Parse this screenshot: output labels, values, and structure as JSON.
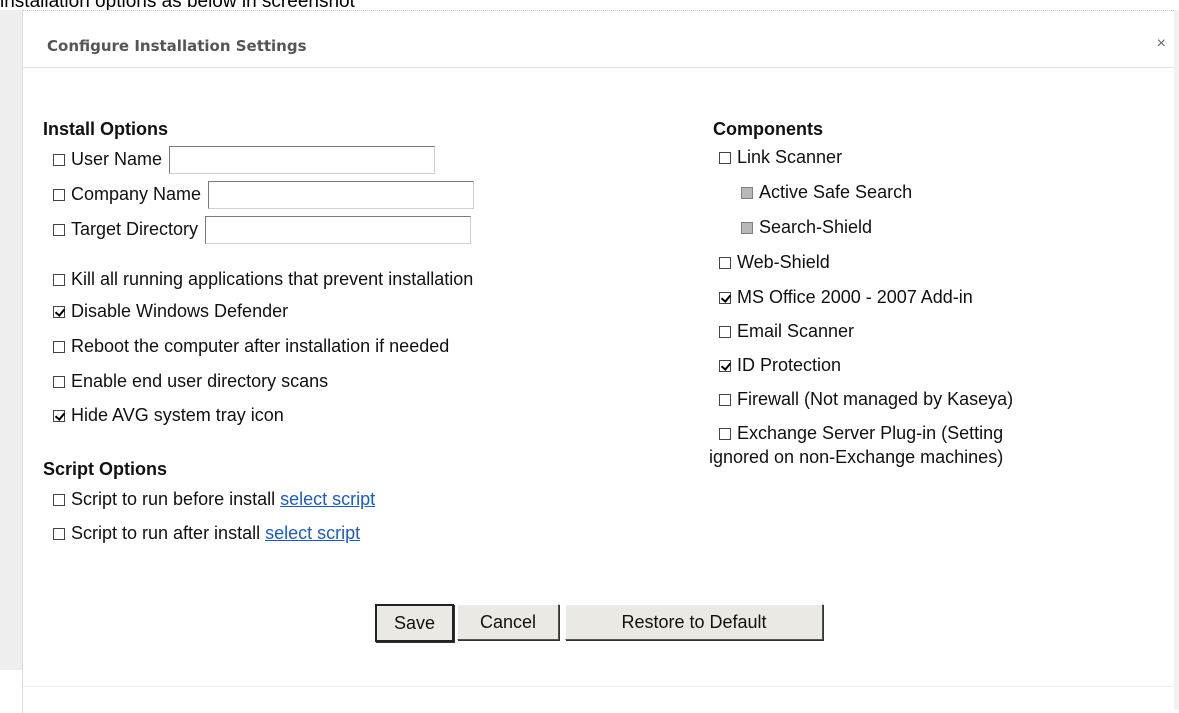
{
  "caption": "installation options as below in screenshot",
  "dialog": {
    "title": "Configure Installation Settings",
    "close_glyph": "×"
  },
  "install_options": {
    "heading": "Install Options",
    "user_name": {
      "label": "User Name",
      "value": "",
      "checked": false
    },
    "company_name": {
      "label": "Company Name",
      "value": "",
      "checked": false
    },
    "target_directory": {
      "label": "Target Directory",
      "value": "",
      "checked": false
    },
    "items": [
      {
        "label": "Kill all running applications that prevent installation",
        "checked": false
      },
      {
        "label": "Disable Windows Defender",
        "checked": true
      },
      {
        "label": "Reboot the computer after installation if needed",
        "checked": false
      },
      {
        "label": "Enable end user directory scans",
        "checked": false
      },
      {
        "label": "Hide AVG system tray icon",
        "checked": true
      }
    ]
  },
  "script_options": {
    "heading": "Script Options",
    "before": {
      "label": "Script to run before install",
      "link": "select script",
      "checked": false
    },
    "after": {
      "label": "Script to run after install",
      "link": "select script",
      "checked": false
    }
  },
  "components": {
    "heading": "Components",
    "items": [
      {
        "label": "Link Scanner",
        "checked": false,
        "disabled": false
      },
      {
        "label": "Active Safe Search",
        "checked": false,
        "disabled": true
      },
      {
        "label": "Search-Shield",
        "checked": false,
        "disabled": true
      },
      {
        "label": "Web-Shield",
        "checked": false,
        "disabled": false
      },
      {
        "label": "MS Office 2000 - 2007 Add-in",
        "checked": true,
        "disabled": false
      },
      {
        "label": "Email Scanner",
        "checked": false,
        "disabled": false
      },
      {
        "label": "ID Protection",
        "checked": true,
        "disabled": false
      },
      {
        "label": "Firewall (Not managed by Kaseya)",
        "checked": false,
        "disabled": false
      }
    ],
    "exchange": {
      "label_line1": "Exchange Server Plug-in (Setting",
      "label_line2": "ignored on non-Exchange machines)",
      "checked": false
    }
  },
  "buttons": {
    "save": "Save",
    "cancel": "Cancel",
    "restore": "Restore to Default"
  }
}
